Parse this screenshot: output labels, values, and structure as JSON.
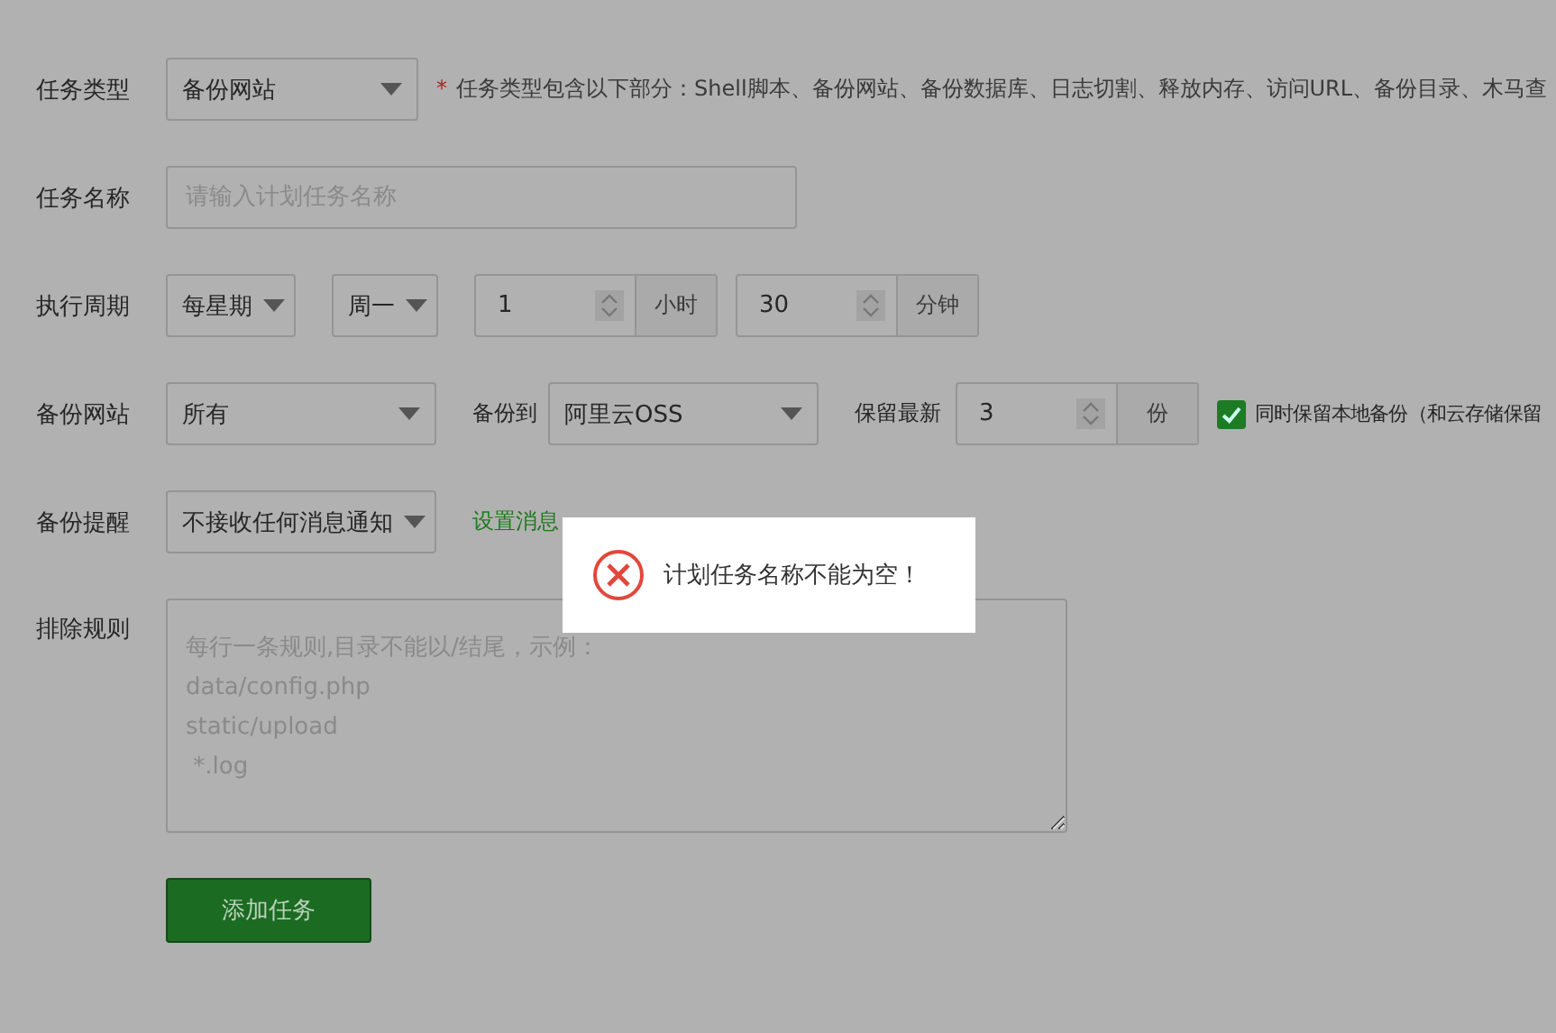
{
  "form": {
    "rows": [
      {
        "label": "任务类型",
        "items": [
          {
            "kind": "select",
            "value": "备份网站"
          },
          {
            "kind": "note",
            "mark": "*",
            "text": "任务类型包含以下部分：Shell脚本、备份网站、备份数据库、日志切割、释放内存、访问URL、备份目录、木马查"
          }
        ]
      },
      {
        "label": "任务名称",
        "items": [
          {
            "kind": "input",
            "placeholder": "请输入计划任务名称"
          }
        ]
      },
      {
        "label": "执行周期",
        "items": [
          {
            "kind": "select",
            "value": "每星期"
          },
          {
            "kind": "select",
            "value": "周一"
          },
          {
            "kind": "spin",
            "value": "1",
            "unit": "小时"
          },
          {
            "kind": "spin",
            "value": "30",
            "unit": "分钟"
          }
        ]
      },
      {
        "label": "备份网站",
        "items": [
          {
            "kind": "select",
            "value": "所有"
          },
          {
            "kind": "text",
            "text": "备份到"
          },
          {
            "kind": "select",
            "value": "阿里云OSS"
          },
          {
            "kind": "text",
            "text": "保留最新"
          },
          {
            "kind": "spin",
            "value": "3",
            "unit": "份"
          },
          {
            "kind": "checkbox",
            "checked": true,
            "text": "同时保留本地备份（和云存储保留"
          }
        ]
      },
      {
        "label": "备份提醒",
        "items": [
          {
            "kind": "select",
            "value": "不接收任何消息通知"
          },
          {
            "kind": "link",
            "text": "设置消息"
          }
        ]
      },
      {
        "label": "排除规则",
        "items": [
          {
            "kind": "textarea",
            "placeholder": "每行一条规则,目录不能以/结尾，示例：\ndata/config.php\nstatic/upload\n *.log"
          }
        ]
      }
    ],
    "submit": "添加任务"
  },
  "toast": {
    "kind": "error",
    "message": "计划任务名称不能为空！"
  }
}
